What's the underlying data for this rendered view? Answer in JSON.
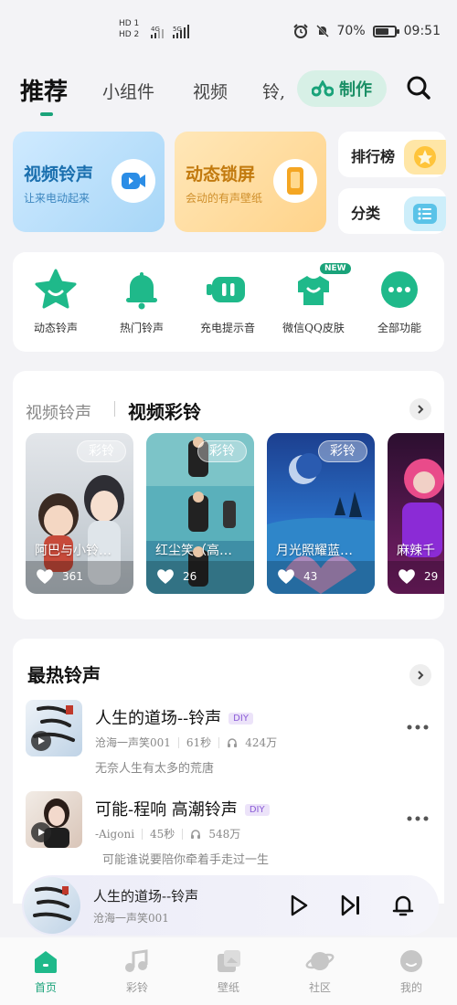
{
  "status_bar": {
    "hd1": "HD 1",
    "hd2": "HD 2",
    "net1": "4G",
    "net2": "5G",
    "battery": "70%",
    "battery_level": 0.7,
    "time": "09:51"
  },
  "tabs": [
    {
      "label": "推荐",
      "active": true
    },
    {
      "label": "小组件"
    },
    {
      "label": "视频"
    },
    {
      "label": "铃,"
    }
  ],
  "make_button": "制作",
  "cards": {
    "video_ringtone": {
      "title": "视频铃声",
      "subtitle": "让来电动起来"
    },
    "live_lock": {
      "title": "动态锁屏",
      "subtitle": "会动的有声壁纸"
    },
    "rank": {
      "title": "排行榜"
    },
    "category": {
      "title": "分类"
    }
  },
  "features": [
    {
      "label": "动态铃声",
      "icon": "star-smile-icon"
    },
    {
      "label": "热门铃声",
      "icon": "bell-icon"
    },
    {
      "label": "充电提示音",
      "icon": "battery-pause-icon"
    },
    {
      "label": "微信QQ皮肤",
      "icon": "shirt-icon",
      "badge": "NEW"
    },
    {
      "label": "全部功能",
      "icon": "more-dots-icon"
    }
  ],
  "video_section": {
    "tab1": "视频铃声",
    "tab2": "视频彩铃",
    "items": [
      {
        "badge": "彩铃",
        "title": "阿巴与小铃…",
        "likes": "361"
      },
      {
        "badge": "彩铃",
        "title": "红尘笑（高…",
        "likes": "26"
      },
      {
        "badge": "彩铃",
        "title": "月光照耀蓝…",
        "likes": "43"
      },
      {
        "badge": "",
        "title": "麻辣千",
        "likes": "29"
      }
    ]
  },
  "hot_section": {
    "title": "最热铃声",
    "items": [
      {
        "name": "人生的道场--铃声",
        "tag": "DIY",
        "artist": "沧海一声笑001",
        "duration": "61秒",
        "plays": "424万",
        "desc": "无奈人生有太多的荒唐"
      },
      {
        "name": "可能-程响  高潮铃声",
        "tag": "DIY",
        "artist": "-Aigoni",
        "duration": "45秒",
        "plays": "548万",
        "desc": "可能谁说要陪你牵着手走过一生"
      }
    ]
  },
  "player": {
    "name": "人生的道场--铃声",
    "artist": "沧海一声笑001"
  },
  "nav": [
    {
      "label": "首页",
      "active": true
    },
    {
      "label": "彩铃"
    },
    {
      "label": "壁纸"
    },
    {
      "label": "社区"
    },
    {
      "label": "我的"
    }
  ],
  "colors": {
    "accent": "#1aa37a",
    "diy_bg": "#ece3f9",
    "diy_text": "#8a5bd6"
  }
}
